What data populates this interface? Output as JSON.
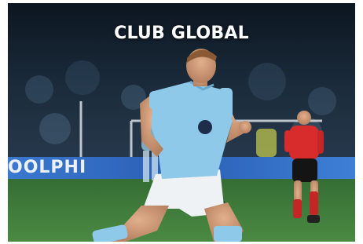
{
  "card": {
    "title": "CLUB GLOBAL",
    "board_text": "OOLPHI",
    "colors": {
      "sky_blue_kit": "#8ec9ea",
      "shorts": "#eef2f5",
      "referee_shirt": "#d82b2b",
      "pitch": "#3f7a3a",
      "board": "#2c62b8",
      "dark_stadium": "#0f1a24"
    }
  }
}
